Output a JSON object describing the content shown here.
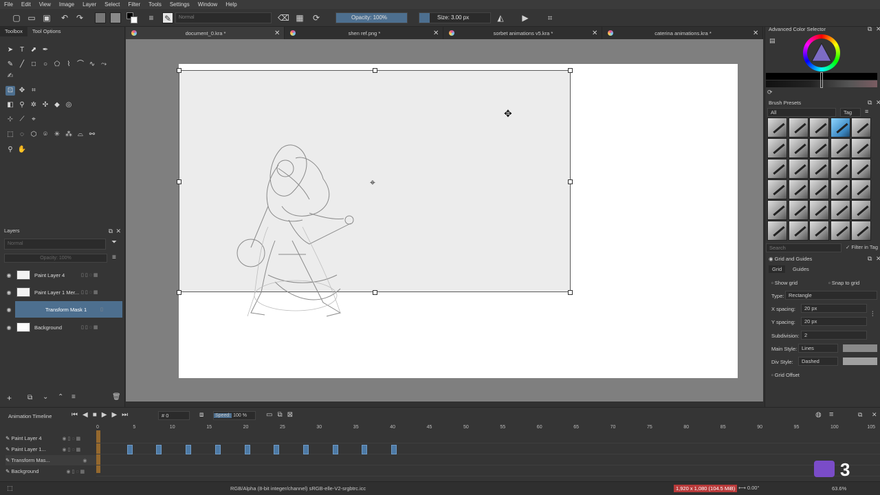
{
  "menu": [
    "File",
    "Edit",
    "View",
    "Image",
    "Layer",
    "Select",
    "Filter",
    "Tools",
    "Settings",
    "Window",
    "Help"
  ],
  "toolbar": {
    "blend_mode": "Normal",
    "opacity_label": "Opacity: 100%",
    "opacity_fraction": 1.0,
    "size_label": "Size: 3.00 px",
    "size_fraction": 0.06
  },
  "left_tabs": [
    "Toolbox",
    "Tool Options"
  ],
  "document_tabs": [
    {
      "title": "document_0.kra *"
    },
    {
      "title": "shen ref.png *"
    },
    {
      "title": "sorbet animations v5.kra *"
    },
    {
      "title": "caterina animations.kra *"
    }
  ],
  "layers_panel": {
    "title": "Layers",
    "blend_mode": "Normal",
    "opacity_label": "Opacity:  100%",
    "layers": [
      {
        "name": "Paint Layer 4"
      },
      {
        "name": "Paint Layer 1 Mer..."
      },
      {
        "name": "Transform Mask 1"
      },
      {
        "name": "Background"
      }
    ]
  },
  "right_panels": {
    "color_selector_title": "Advanced Color Selector",
    "brush_presets_title": "Brush Presets",
    "brush_filter": "All",
    "brush_tag": "Tag",
    "brush_search_placeholder": "Search",
    "filter_in_tag": "Filter in Tag",
    "grid_title": "Grid and Guides",
    "grid_tabs": [
      "Grid",
      "Guides"
    ],
    "show_grid": "Show grid",
    "snap_to_grid": "Snap to grid",
    "type_label": "Type:",
    "type_value": "Rectangle",
    "x_spacing_label": "X spacing:",
    "x_spacing_value": "20 px",
    "y_spacing_label": "Y spacing:",
    "y_spacing_value": "20 px",
    "subdivision_label": "Subdivision:",
    "subdivision_value": "2",
    "main_style_label": "Main Style:",
    "main_style_value": "Lines",
    "div_style_label": "Div Style:",
    "div_style_value": "Dashed",
    "grid_offset": "Grid Offset"
  },
  "timeline": {
    "title": "Animation Timeline",
    "frame": "0",
    "speed_label": "Speed:",
    "speed_value": "100 %",
    "ruler": [
      "0",
      "5",
      "10",
      "15",
      "20",
      "25",
      "30",
      "35",
      "40",
      "45",
      "50",
      "55",
      "60",
      "65",
      "70",
      "75",
      "80",
      "85",
      "90",
      "95",
      "100",
      "105"
    ],
    "tracks": [
      "Paint Layer 4",
      "Paint Layer 1...",
      "Transform Mas...",
      "Background"
    ],
    "keyframes": [
      4,
      8,
      12,
      16,
      20,
      24,
      28,
      32,
      36,
      40
    ]
  },
  "status": {
    "colorspace": "RGB/Alpha (8-bit integer/channel)  sRGB-elle-V2-srgbtrc.icc",
    "dimensions": "1,920 x 1,080 (104.5 MiB)",
    "rotation": "0.00°",
    "zoom": "63.6%"
  },
  "overlay_badge": "3",
  "colors": {
    "accent": "#4d6f8f",
    "keyframe": "#4d7aa6"
  }
}
